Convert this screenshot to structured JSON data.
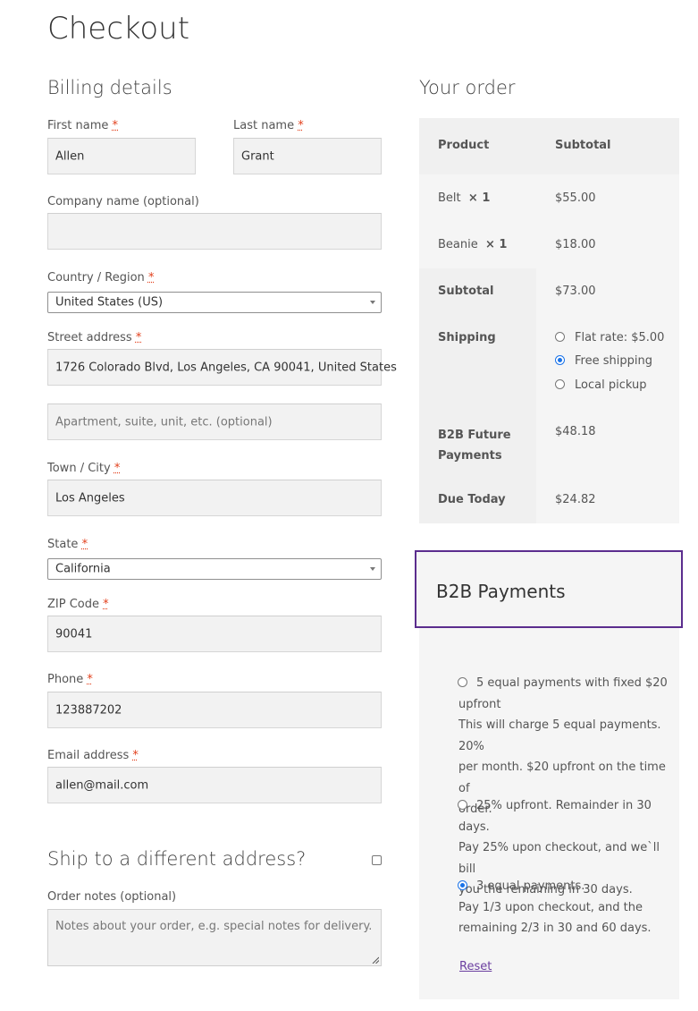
{
  "page": {
    "title": "Checkout"
  },
  "billing": {
    "title": "Billing details",
    "first_name": {
      "label": "First name",
      "value": "Allen"
    },
    "last_name": {
      "label": "Last name",
      "value": "Grant"
    },
    "company": {
      "label": "Company name (optional)",
      "value": ""
    },
    "country": {
      "label": "Country / Region",
      "value": "United States (US)"
    },
    "street": {
      "label": "Street address",
      "value": "1726 Colorado Blvd, Los Angeles, CA 90041, United States",
      "placeholder2": "Apartment, suite, unit, etc. (optional)"
    },
    "city": {
      "label": "Town / City",
      "value": "Los Angeles"
    },
    "state": {
      "label": "State",
      "value": "California"
    },
    "zip": {
      "label": "ZIP Code",
      "value": "90041"
    },
    "phone": {
      "label": "Phone",
      "value": "123887202"
    },
    "email": {
      "label": "Email address",
      "value": "allen@mail.com"
    },
    "required_mark": "*"
  },
  "ship_different": {
    "label": "Ship to a different address?",
    "checked": false
  },
  "order_notes": {
    "label": "Order notes (optional)",
    "placeholder": "Notes about your order, e.g. special notes for delivery."
  },
  "order": {
    "title": "Your order",
    "col_product": "Product",
    "col_subtotal": "Subtotal",
    "items": [
      {
        "name": "Belt",
        "qty": "× 1",
        "price": "$55.00"
      },
      {
        "name": "Beanie",
        "qty": "× 1",
        "price": "$18.00"
      }
    ],
    "subtotal_label": "Subtotal",
    "subtotal_value": "$73.00",
    "shipping_label": "Shipping",
    "shipping_options": [
      {
        "label": "Flat rate: $5.00",
        "selected": false
      },
      {
        "label": "Free shipping",
        "selected": true
      },
      {
        "label": "Local pickup",
        "selected": false
      }
    ],
    "b2b_future_label_1": "B2B Future",
    "b2b_future_label_2": "Payments",
    "b2b_future_value": "$48.18",
    "due_today_label": "Due Today",
    "due_today_value": "$24.82"
  },
  "b2b": {
    "title": "B2B Payments",
    "options": [
      {
        "line1": "5 equal payments with fixed $20",
        "line2": "upfront",
        "desc": [
          "This will charge 5 equal payments. 20%",
          "per month. $20 upfront on the time of",
          "order."
        ],
        "selected": false
      },
      {
        "line1": "25% upfront. Remainder in 30 days.",
        "desc": [
          "Pay 25% upon checkout, and we`ll bill",
          "you the remaining in 30 days."
        ],
        "selected": false
      },
      {
        "line1": "3 equal payments.",
        "desc": [
          "Pay 1/3 upon checkout, and the",
          "remaining 2/3 in 30 and 60 days."
        ],
        "selected": true
      }
    ],
    "reset_label": "Reset"
  },
  "colors": {
    "accent_purple": "#5b2d8e",
    "radio_blue": "#1a73e8",
    "required_red": "#e2401c"
  }
}
